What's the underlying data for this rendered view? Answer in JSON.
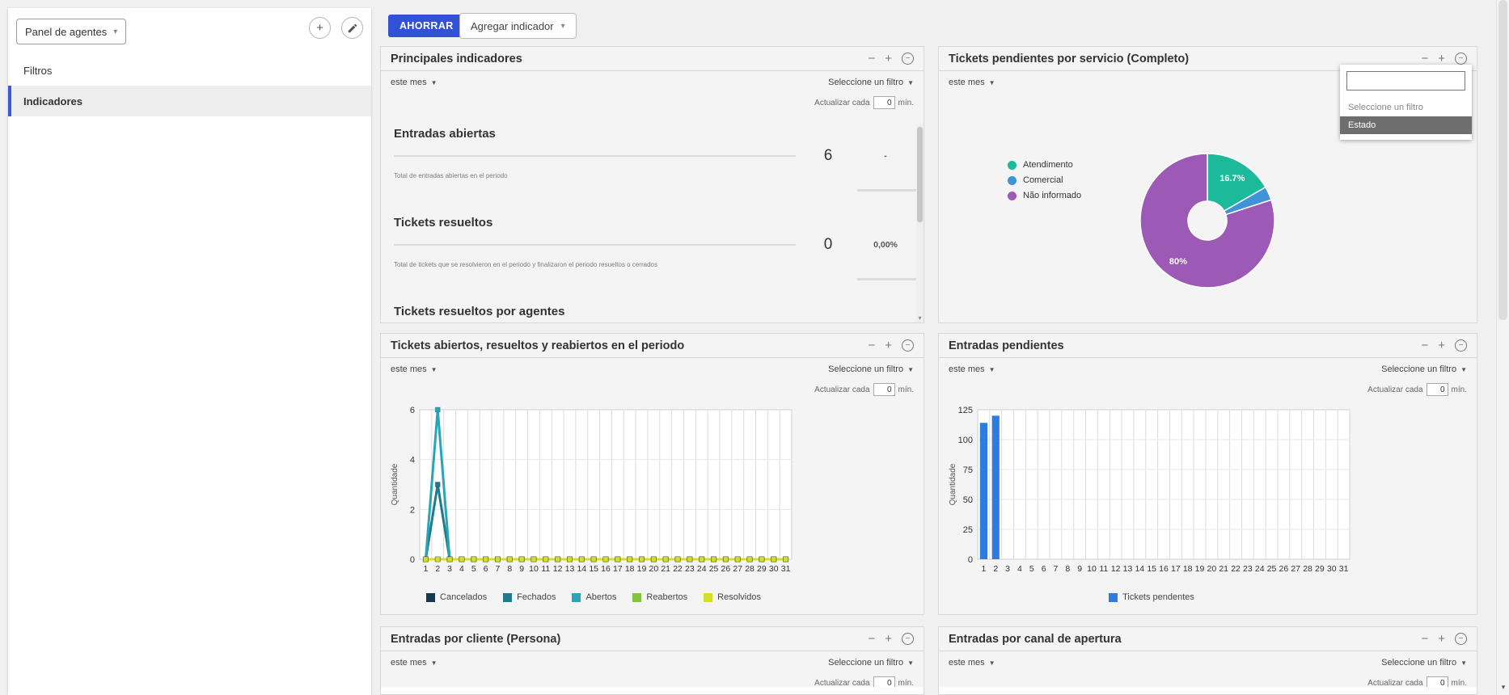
{
  "sidebar": {
    "panel_selector_label": "Panel de agentes",
    "items": [
      {
        "label": "Filtros"
      },
      {
        "label": "Indicadores"
      }
    ]
  },
  "toolbar": {
    "save_label": "AHORRAR",
    "add_indicator_label": "Agregar indicador"
  },
  "widget_common": {
    "period_label": "este mes",
    "filter_label": "Seleccione un filtro",
    "refresh_prefix": "Actualizar cada",
    "refresh_value": "0",
    "refresh_suffix": "mín."
  },
  "filter_dropdown": {
    "input_value": "",
    "options": [
      {
        "label": "Seleccione un filtro",
        "highlighted": false
      },
      {
        "label": "Estado",
        "highlighted": true
      }
    ]
  },
  "panels": [
    {
      "title": "Principales indicadores"
    },
    {
      "title": "Tickets pendientes por servicio (Completo)"
    },
    {
      "title": "Tickets abiertos, resueltos y reabiertos en el periodo"
    },
    {
      "title": "Entradas pendientes"
    },
    {
      "title": "Entradas por cliente (Persona)"
    },
    {
      "title": "Entradas por canal de apertura"
    }
  ],
  "indicators": [
    {
      "title": "Entradas abiertas",
      "value": "6",
      "secondary": "-",
      "description": "Total de entradas abiertas en el periodo"
    },
    {
      "title": "Tickets resueltos",
      "value": "0",
      "secondary": "0,00%",
      "description": "Total de tickets que se resolvieron en el periodo y finalizaron el periodo resueltos o cerrados"
    },
    {
      "title": "Tickets resueltos por agentes",
      "value": "",
      "secondary": "",
      "description": ""
    }
  ],
  "chart_data": [
    {
      "type": "pie",
      "donut": true,
      "title": "Tickets pendientes por servicio (Completo)",
      "categories": [
        "Atendimento",
        "Comercial",
        "Não informado"
      ],
      "values": [
        16.7,
        3.3,
        80
      ],
      "slice_labels": [
        "16.7%",
        "",
        "80%"
      ],
      "colors": [
        "#1cb99a",
        "#3f93d6",
        "#9c59b5"
      ],
      "legend_position": "left"
    },
    {
      "type": "line",
      "title": "Tickets abiertos, resueltos y reabiertos en el periodo",
      "x": [
        1,
        2,
        3,
        4,
        5,
        6,
        7,
        8,
        9,
        10,
        11,
        12,
        13,
        14,
        15,
        16,
        17,
        18,
        19,
        20,
        21,
        22,
        23,
        24,
        25,
        26,
        27,
        28,
        29,
        30,
        31
      ],
      "ylabel": "Quantidade",
      "ylim": [
        0,
        6
      ],
      "yticks": [
        0,
        2,
        4,
        6
      ],
      "grid": true,
      "legend_position": "bottom",
      "series": [
        {
          "name": "Cancelados",
          "color": "#14384d",
          "values": [
            0,
            0,
            0,
            0,
            0,
            0,
            0,
            0,
            0,
            0,
            0,
            0,
            0,
            0,
            0,
            0,
            0,
            0,
            0,
            0,
            0,
            0,
            0,
            0,
            0,
            0,
            0,
            0,
            0,
            0,
            0
          ]
        },
        {
          "name": "Fechados",
          "color": "#1f7a8c",
          "values": [
            0,
            3,
            0,
            0,
            0,
            0,
            0,
            0,
            0,
            0,
            0,
            0,
            0,
            0,
            0,
            0,
            0,
            0,
            0,
            0,
            0,
            0,
            0,
            0,
            0,
            0,
            0,
            0,
            0,
            0,
            0
          ]
        },
        {
          "name": "Abertos",
          "color": "#2aa5b8",
          "values": [
            0,
            6,
            0,
            0,
            0,
            0,
            0,
            0,
            0,
            0,
            0,
            0,
            0,
            0,
            0,
            0,
            0,
            0,
            0,
            0,
            0,
            0,
            0,
            0,
            0,
            0,
            0,
            0,
            0,
            0,
            0
          ]
        },
        {
          "name": "Reabertos",
          "color": "#84c340",
          "values": [
            0,
            0,
            0,
            0,
            0,
            0,
            0,
            0,
            0,
            0,
            0,
            0,
            0,
            0,
            0,
            0,
            0,
            0,
            0,
            0,
            0,
            0,
            0,
            0,
            0,
            0,
            0,
            0,
            0,
            0,
            0
          ]
        },
        {
          "name": "Resolvidos",
          "color": "#d5de2b",
          "values": [
            0,
            0,
            0,
            0,
            0,
            0,
            0,
            0,
            0,
            0,
            0,
            0,
            0,
            0,
            0,
            0,
            0,
            0,
            0,
            0,
            0,
            0,
            0,
            0,
            0,
            0,
            0,
            0,
            0,
            0,
            0
          ]
        }
      ]
    },
    {
      "type": "bar",
      "title": "Entradas pendientes",
      "x": [
        1,
        2,
        3,
        4,
        5,
        6,
        7,
        8,
        9,
        10,
        11,
        12,
        13,
        14,
        15,
        16,
        17,
        18,
        19,
        20,
        21,
        22,
        23,
        24,
        25,
        26,
        27,
        28,
        29,
        30,
        31
      ],
      "ylabel": "Quantidade",
      "ylim": [
        0,
        125
      ],
      "yticks": [
        0,
        25,
        50,
        75,
        100,
        125
      ],
      "grid": true,
      "legend_position": "bottom",
      "series": [
        {
          "name": "Tickets pendentes",
          "color": "#2d7de1",
          "values": [
            114,
            120,
            0,
            0,
            0,
            0,
            0,
            0,
            0,
            0,
            0,
            0,
            0,
            0,
            0,
            0,
            0,
            0,
            0,
            0,
            0,
            0,
            0,
            0,
            0,
            0,
            0,
            0,
            0,
            0,
            0
          ]
        }
      ]
    }
  ],
  "colors": {
    "accent_blue": "#3152d4",
    "selected_border": "#3d57d8",
    "dropdown_highlight": "#6e6e6e"
  }
}
